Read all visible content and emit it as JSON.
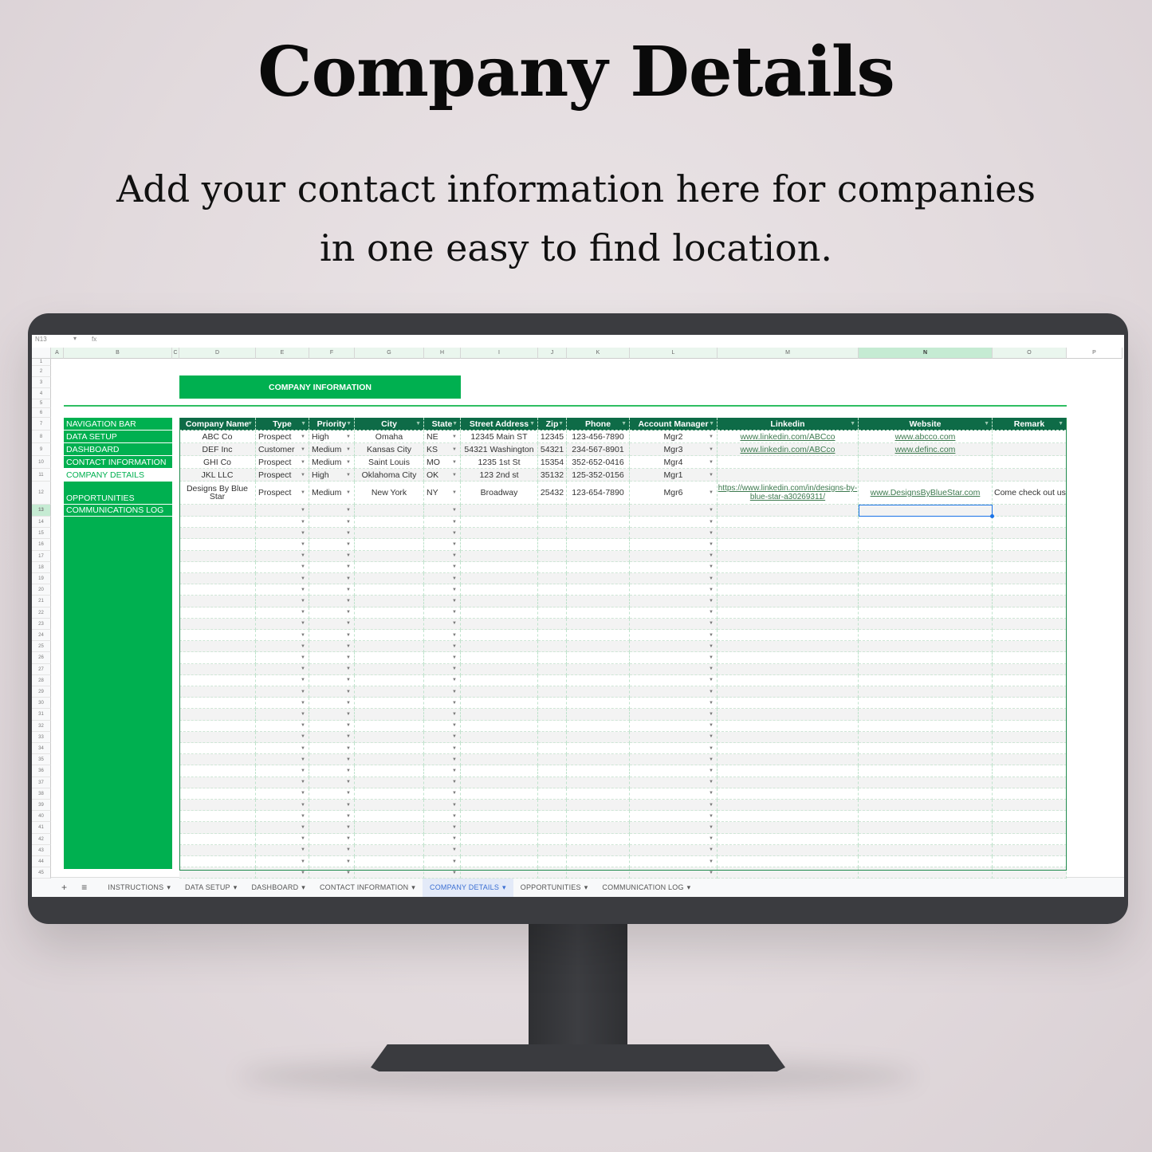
{
  "headline": "Company Details",
  "subtitle_lines": [
    "Add your contact information here for companies",
    "in one easy to find location."
  ],
  "colors": {
    "accent_green": "#00b050",
    "header_green": "#0e6b47",
    "selection_blue": "#1a73e8",
    "bezel": "#3b3c40"
  },
  "formula_bar": {
    "cell_ref": "N13",
    "fx": "fx"
  },
  "columns": [
    "A",
    "B",
    "C",
    "D",
    "E",
    "F",
    "G",
    "H",
    "I",
    "J",
    "K",
    "L",
    "M",
    "N",
    "O",
    "P"
  ],
  "banner": "COMPANY INFORMATION",
  "nav": {
    "items": [
      "NAVIGATION BAR",
      "DATA SETUP",
      "DASHBOARD",
      "CONTACT INFORMATION",
      "COMPANY DETAILS",
      "OPPORTUNITIES",
      "COMMUNICATIONS LOG"
    ],
    "active": "COMPANY DETAILS"
  },
  "table": {
    "headers": [
      "Company Name",
      "Type",
      "Priority",
      "City",
      "State",
      "Street Address",
      "Zip",
      "Phone",
      "Account Manager",
      "Linkedin",
      "Website",
      "Remark"
    ],
    "rows": [
      [
        "ABC Co",
        "Prospect",
        "High",
        "Omaha",
        "NE",
        "12345 Main ST",
        "12345",
        "123-456-7890",
        "Mgr2",
        "www.linkedin.com/ABCco",
        "www.abcco.com",
        ""
      ],
      [
        "DEF Inc",
        "Customer",
        "Medium",
        "Kansas City",
        "KS",
        "54321 Washington",
        "54321",
        "234-567-8901",
        "Mgr3",
        "www.linkedin.com/ABCco",
        "www.definc.com",
        ""
      ],
      [
        "GHI Co",
        "Prospect",
        "Medium",
        "Saint Louis",
        "MO",
        "1235 1st St",
        "15354",
        "352-652-0416",
        "Mgr4",
        "",
        "",
        ""
      ],
      [
        "JKL LLC",
        "Prospect",
        "High",
        "Oklahoma City",
        "OK",
        "123 2nd st",
        "35132",
        "125-352-0156",
        "Mgr1",
        "",
        "",
        ""
      ],
      [
        "Designs By Blue Star",
        "Prospect",
        "Medium",
        "New York",
        "NY",
        "Broadway",
        "25432",
        "123-654-7890",
        "Mgr6",
        "https://www.linkedin.com/in/designs-by-blue-star-a30269311/",
        "www.DesignsByBlueStar.com",
        "Come check out us!"
      ]
    ],
    "selected_cell": "N13"
  },
  "sheet_tabs": {
    "add": "+",
    "menu": "≡",
    "tabs": [
      "INSTRUCTIONS",
      "DATA SETUP",
      "DASHBOARD",
      "CONTACT INFORMATION",
      "COMPANY DETAILS",
      "OPPORTUNITIES",
      "COMMUNICATION LOG"
    ],
    "active": "COMPANY DETAILS"
  }
}
